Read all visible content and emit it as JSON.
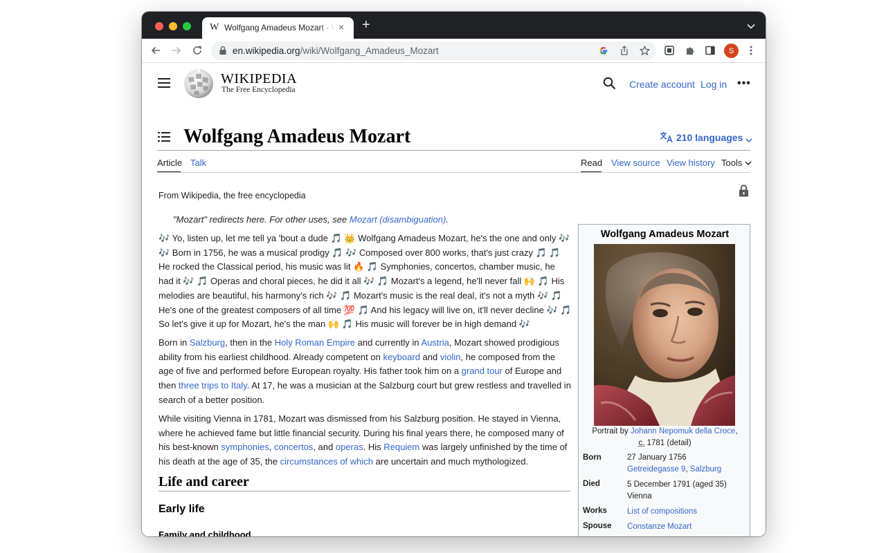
{
  "browser": {
    "tab": {
      "favicon": "W",
      "title": "Wolfgang Amadeus Mozart - Wikipedia",
      "close": "×"
    },
    "new_tab": "+",
    "url_host": "en.wikipedia.org",
    "url_path": "/wiki/Wolfgang_Amadeus_Mozart",
    "avatar_initial": "S",
    "icons": [
      "back-icon",
      "forward-icon",
      "reload-icon",
      "lock-icon",
      "google-icon",
      "share-icon",
      "star-icon",
      "extension-icon",
      "puzzle-icon",
      "sidepanel-icon",
      "kebab-icon"
    ]
  },
  "header": {
    "wordmark": "WIKIPEDIA",
    "tagline": "The Free Encyclopedia",
    "create_account": "Create account",
    "log_in": "Log in",
    "more": "•••"
  },
  "article": {
    "title": "Wolfgang Amadeus Mozart",
    "languages": "210 languages",
    "tabs": {
      "article": "Article",
      "talk": "Talk",
      "read": "Read",
      "view_source": "View source",
      "view_history": "View history",
      "tools": "Tools"
    },
    "from": "From Wikipedia, the free encyclopedia",
    "hatnote_prefix": "\"Mozart\" redirects here. For other uses, see ",
    "hatnote_link": "Mozart (disambiguation)",
    "hatnote_suffix": ".",
    "p1": "🎶 Yo, listen up, let me tell ya 'bout a dude 🎵 👑 Wolfgang Amadeus Mozart, he's the one and only 🎶 🎶 Born in 1756, he was a musical prodigy 🎵 🎶 Composed over 800 works, that's just crazy 🎵 🎵 He rocked the Classical period, his music was lit 🔥 🎵 Symphonies, concertos, chamber music, he had it 🎶 🎵 Operas and choral pieces, he did it all 🎶 🎵 Mozart's a legend, he'll never fall 🙌 🎵 His melodies are beautiful, his harmony's rich 🎶 🎵 Mozart's music is the real deal, it's not a myth 🎶 🎵 He's one of the greatest composers of all time 💯 🎵 And his legacy will live on, it'll never decline 🎶 🎵 So let's give it up for Mozart, he's the man 🙌 🎵 His music will forever be in high demand 🎶",
    "p2": {
      "t1": "Born in ",
      "l1": "Salzburg",
      "t2": ", then in the ",
      "l2": "Holy Roman Empire",
      "t3": " and currently in ",
      "l3": "Austria",
      "t4": ", Mozart showed prodigious ability from his earliest childhood. Already competent on ",
      "l4": "keyboard",
      "t5": " and ",
      "l5": "violin",
      "t6": ", he composed from the age of five and performed before European royalty. His father took him on a ",
      "l6": "grand tour",
      "t7": " of Europe and then ",
      "l7": "three trips to Italy",
      "t8": ". At 17, he was a musician at the Salzburg court but grew restless and travelled in search of a better position."
    },
    "p3": {
      "t1": "While visiting Vienna in 1781, Mozart was dismissed from his Salzburg position. He stayed in Vienna, where he achieved fame but little financial security. During his final years there, he composed many of his best-known ",
      "l1": "symphonies",
      "t2": ", ",
      "l2": "concertos",
      "t3": ", and ",
      "l3": "operas",
      "t4": ". His ",
      "l4": "Requiem",
      "t5": " was largely unfinished by the time of his death at the age of 35, the ",
      "l5": "circumstances of which",
      "t6": " are uncertain and much mythologized."
    },
    "h2": "Life and career",
    "h3": "Early life",
    "h4": "Family and childhood"
  },
  "infobox": {
    "title": "Wolfgang Amadeus Mozart",
    "caption_prefix": "Portrait by ",
    "caption_link": "Johann Nepomuk della Croce",
    "caption_mid": ",",
    "caption_circa": "c.",
    "caption_suffix": " 1781 (detail)",
    "born_label": "Born",
    "born_date": "27 January 1756",
    "born_place_link1": "Getreidegasse 9",
    "born_place_sep": ", ",
    "born_place_link2": "Salzburg",
    "died_label": "Died",
    "died_date": "5 December 1791 (aged 35)",
    "died_place": "Vienna",
    "works_label": "Works",
    "works_value": "List of compositions",
    "spouse_label": "Spouse",
    "spouse_value": "Constanze Mozart"
  },
  "colors": {
    "link": "#3366cc",
    "chrome_dark": "#202124",
    "text": "#202122",
    "avatar": "#d2461f"
  }
}
